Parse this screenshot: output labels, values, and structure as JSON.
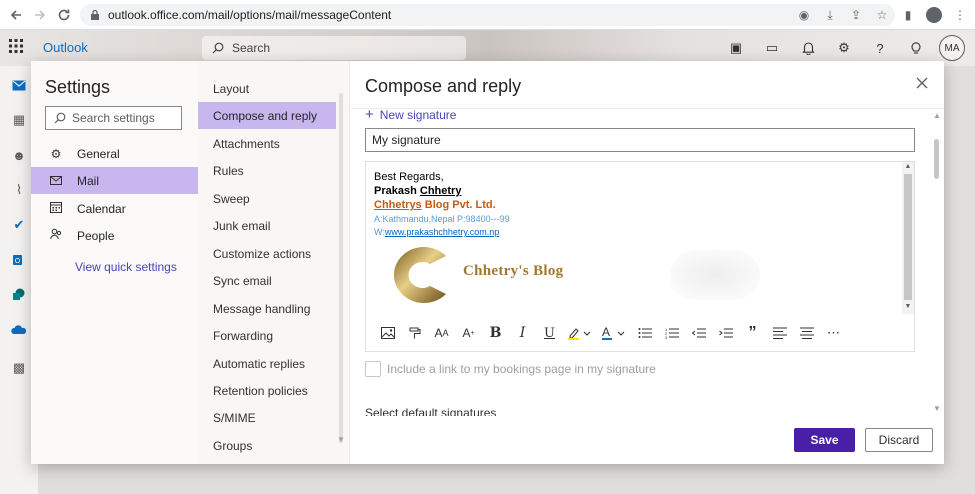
{
  "browser": {
    "url": "outlook.office.com/mail/options/mail/messageContent",
    "back_icon": "back-arrow-icon",
    "forward_icon": "forward-arrow-icon",
    "reload_icon": "reload-icon"
  },
  "header": {
    "app_title": "Outlook",
    "search_placeholder": "Search",
    "avatar_initials": "MA"
  },
  "settings": {
    "title": "Settings",
    "search_placeholder": "Search settings",
    "categories": [
      {
        "label": "General",
        "icon": "gear-icon"
      },
      {
        "label": "Mail",
        "icon": "mail-icon",
        "active": true
      },
      {
        "label": "Calendar",
        "icon": "calendar-icon"
      },
      {
        "label": "People",
        "icon": "people-icon"
      }
    ],
    "view_quick_settings": "View quick settings"
  },
  "mail_nav": {
    "items": [
      "Layout",
      "Compose and reply",
      "Attachments",
      "Rules",
      "Sweep",
      "Junk email",
      "Customize actions",
      "Sync email",
      "Message handling",
      "Forwarding",
      "Automatic replies",
      "Retention policies",
      "S/MIME",
      "Groups"
    ],
    "active_index": 1
  },
  "pane": {
    "title": "Compose and reply",
    "new_signature": "New signature",
    "signature_name": "My signature",
    "signature": {
      "line1": "Best Regards,",
      "name_first": "Prakash ",
      "name_last": "Chhetry",
      "company_link": "Chhetrys",
      "company_rest": " Blog Pvt. Ltd.",
      "address": "A:Kathmandu,Nepal P:98400---99",
      "web_prefix": "W:",
      "web_link": "www.prakashchhetry.com.np",
      "logo_text": "Chhetry's Blog"
    },
    "bookings_label": "Include a link to my bookings page in my signature",
    "default_signatures": "Select default signatures",
    "save_label": "Save",
    "discard_label": "Discard"
  },
  "colors": {
    "accent": "#4a1fa8",
    "nav_selected": "#c8b7ee",
    "link": "#4a46b4",
    "company_orange": "#c55a11",
    "logo_gold": "#a0782e"
  }
}
